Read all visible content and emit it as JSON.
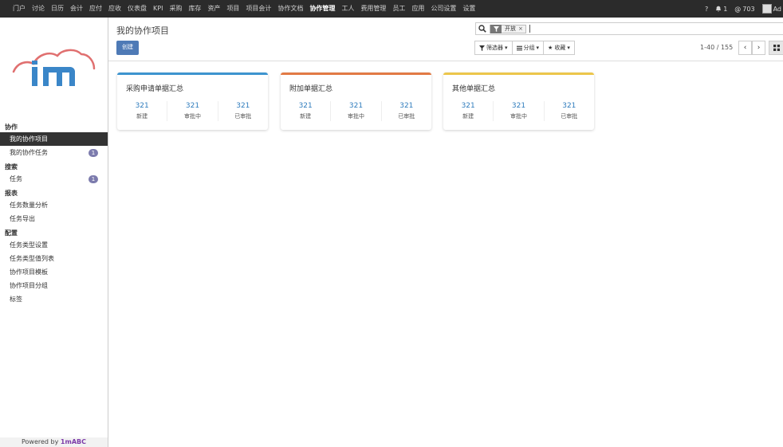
{
  "topnav": {
    "items": [
      "门户",
      "讨论",
      "日历",
      "会计",
      "应付",
      "应收",
      "仪表盘",
      "KPI",
      "采购",
      "库存",
      "资产",
      "项目",
      "项目会计",
      "协作文档",
      "协作管理",
      "工人",
      "费用管理",
      "员工",
      "应用",
      "公司设置",
      "设置"
    ],
    "active": "协作管理",
    "help": "?",
    "notifications": "1",
    "mentions": "703",
    "user": "Ad"
  },
  "sidebar": {
    "sections": [
      {
        "title": "协作",
        "items": [
          {
            "label": "我的协作项目",
            "active": true
          },
          {
            "label": "我的协作任务",
            "badge": "1"
          }
        ]
      },
      {
        "title": "搜索",
        "items": [
          {
            "label": "任务",
            "badge": "1"
          }
        ]
      },
      {
        "title": "报表",
        "items": [
          {
            "label": "任务数量分析"
          },
          {
            "label": "任务导出"
          }
        ]
      },
      {
        "title": "配置",
        "items": [
          {
            "label": "任务类型设置"
          },
          {
            "label": "任务类型值列表"
          },
          {
            "label": "协作项目模板"
          },
          {
            "label": "协作项目分组"
          },
          {
            "label": "标签"
          }
        ]
      }
    ],
    "powered_prefix": "Powered by",
    "powered_brand": "1mABC"
  },
  "control": {
    "title": "我的协作项目",
    "create_label": "创建",
    "facet_label": "开放",
    "facet_close": "×",
    "filter_label": "筛选器",
    "group_label": "分组",
    "fav_label": "收藏",
    "pager": "1-40 / 155"
  },
  "cards": [
    {
      "title": "采购申请单据汇总",
      "color": "#3d94cf",
      "stats": [
        {
          "num": "321",
          "label": "新建"
        },
        {
          "num": "321",
          "label": "审批中"
        },
        {
          "num": "321",
          "label": "已审批"
        }
      ]
    },
    {
      "title": "附加单据汇总",
      "color": "#e27a45",
      "stats": [
        {
          "num": "321",
          "label": "新建"
        },
        {
          "num": "321",
          "label": "审批中"
        },
        {
          "num": "321",
          "label": "已审批"
        }
      ]
    },
    {
      "title": "其他单据汇总",
      "color": "#ecc64b",
      "stats": [
        {
          "num": "321",
          "label": "新建"
        },
        {
          "num": "321",
          "label": "审批中"
        },
        {
          "num": "321",
          "label": "已审批"
        }
      ]
    }
  ],
  "colors": {
    "topbar": "#2b2b2b",
    "primary": "#4e7ab6",
    "stat": "#2f7cbd",
    "badge": "#7c7bad",
    "logo_cloud": "#e07070",
    "logo_text": "#3a86c8"
  }
}
